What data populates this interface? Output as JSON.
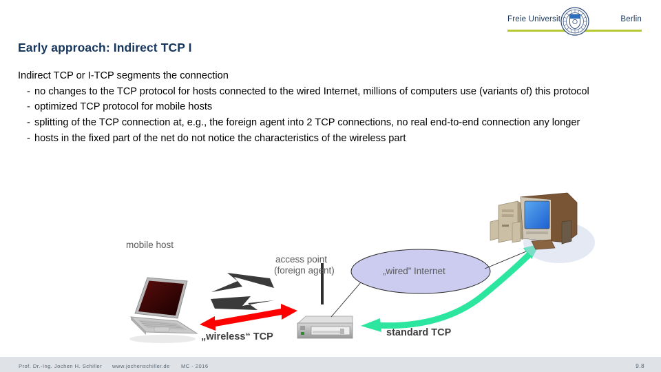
{
  "logo": {
    "left_text": "Freie Universität",
    "right_text": "Berlin",
    "rule_color": "#b8c832",
    "text_color": "#17365d",
    "seal_name": "fu-berlin-seal"
  },
  "title": "Early approach: Indirect TCP I",
  "content": {
    "lead": "Indirect TCP or I-TCP segments the connection",
    "bullets": [
      "no changes to the TCP protocol for hosts connected to the wired Internet, millions of computers use (variants of) this protocol",
      "optimized TCP protocol for mobile hosts",
      "splitting of the TCP connection at, e.g., the foreign agent into 2 TCP connections, no real end-to-end connection any longer",
      "hosts in the fixed part of the net do not notice the characteristics of the wireless part"
    ],
    "bullet_marker": "-"
  },
  "diagram": {
    "labels": {
      "mobile_host": "mobile host",
      "access_point_line1": "access point",
      "access_point_line2": "(foreign agent)",
      "internet_cloud": "„wired” Internet",
      "wireless_tcp": "„wireless“ TCP",
      "standard_tcp": "standard TCP"
    },
    "colors": {
      "wireless_arrow": "#ff0000",
      "standard_arrow": "#2ce6a0",
      "signal_arrow": "#3a3a3a",
      "cloud_fill": "#ccccf0",
      "cloud_stroke": "#2a2a2a",
      "label_gray": "#595959",
      "label_dark": "#404040"
    },
    "icons": {
      "laptop": "laptop-icon",
      "access_point": "access-point-icon",
      "desktop": "desktop-computer-icon"
    }
  },
  "footer": {
    "author": "Prof. Dr.-Ing. Jochen H. Schiller",
    "url": "www.jochenschiller.de",
    "course": "MC - 2016",
    "page": "9.8",
    "bar_color": "#dfe3e8"
  }
}
